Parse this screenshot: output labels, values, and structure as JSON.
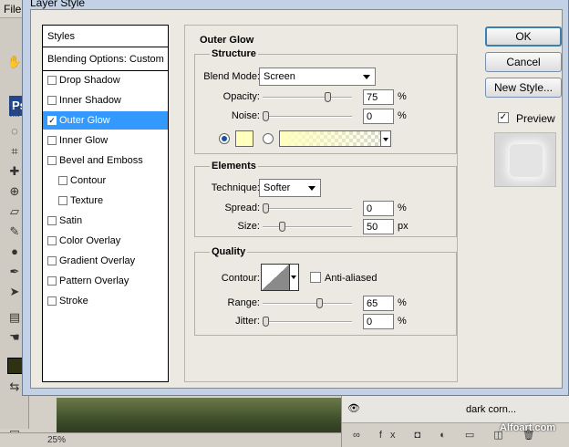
{
  "background": {
    "menu_label": "File",
    "tool_badge": "Ps",
    "zoom": "25%",
    "layer_name": "dark corn...",
    "layer_icons": "∞ fx ◘ ◐ ▭ ◫ 🗑",
    "watermark": "Alfoart.com"
  },
  "dialog": {
    "title": "Layer Style"
  },
  "styles_list": {
    "header": "Styles",
    "blending": "Blending Options: Custom",
    "items": [
      {
        "label": "Drop Shadow",
        "checked": false,
        "selected": false,
        "sub": false
      },
      {
        "label": "Inner Shadow",
        "checked": false,
        "selected": false,
        "sub": false
      },
      {
        "label": "Outer Glow",
        "checked": true,
        "selected": true,
        "sub": false
      },
      {
        "label": "Inner Glow",
        "checked": false,
        "selected": false,
        "sub": false
      },
      {
        "label": "Bevel and Emboss",
        "checked": false,
        "selected": false,
        "sub": false
      },
      {
        "label": "Contour",
        "checked": false,
        "selected": false,
        "sub": true
      },
      {
        "label": "Texture",
        "checked": false,
        "selected": false,
        "sub": true
      },
      {
        "label": "Satin",
        "checked": false,
        "selected": false,
        "sub": false
      },
      {
        "label": "Color Overlay",
        "checked": false,
        "selected": false,
        "sub": false
      },
      {
        "label": "Gradient Overlay",
        "checked": false,
        "selected": false,
        "sub": false
      },
      {
        "label": "Pattern Overlay",
        "checked": false,
        "selected": false,
        "sub": false
      },
      {
        "label": "Stroke",
        "checked": false,
        "selected": false,
        "sub": false
      }
    ]
  },
  "outer_glow": {
    "title": "Outer Glow",
    "structure": {
      "title": "Structure",
      "blend_mode_label": "Blend Mode:",
      "blend_mode_value": "Screen",
      "opacity_label": "Opacity:",
      "opacity_value": "75",
      "opacity_level": 0.75,
      "noise_label": "Noise:",
      "noise_value": "0",
      "noise_level": 0,
      "unit": "%",
      "glow_color": "#ffffbe"
    },
    "elements": {
      "title": "Elements",
      "technique_label": "Technique:",
      "technique_value": "Softer",
      "spread_label": "Spread:",
      "spread_value": "0",
      "spread_level": 0,
      "spread_unit": "%",
      "size_label": "Size:",
      "size_value": "50",
      "size_level": 0.2,
      "size_unit": "px"
    },
    "quality": {
      "title": "Quality",
      "contour_label": "Contour:",
      "anti_aliased_label": "Anti-aliased",
      "range_label": "Range:",
      "range_value": "65",
      "range_level": 0.65,
      "range_unit": "%",
      "jitter_label": "Jitter:",
      "jitter_value": "0",
      "jitter_level": 0,
      "jitter_unit": "%"
    }
  },
  "buttons": {
    "ok": "OK",
    "cancel": "Cancel",
    "new_style": "New Style...",
    "preview_label": "Preview",
    "preview_checked": true
  }
}
